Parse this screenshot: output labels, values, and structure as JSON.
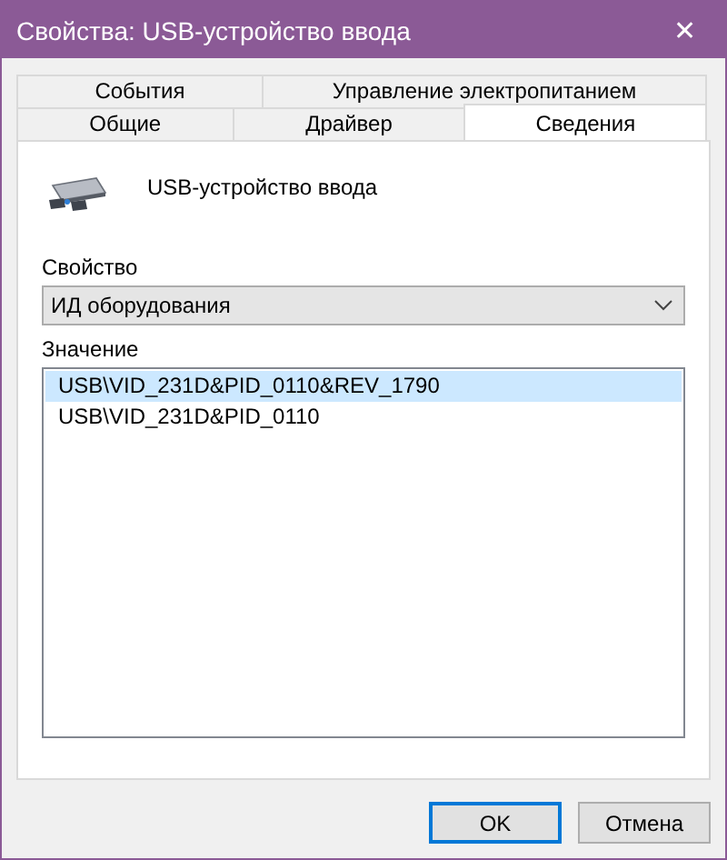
{
  "window": {
    "title": "Свойства: USB-устройство ввода",
    "close": "✕"
  },
  "tab_rows": [
    [
      {
        "label": "События",
        "selected": false
      },
      {
        "label": "Управление электропитанием",
        "selected": false
      }
    ],
    [
      {
        "label": "Общие",
        "selected": false
      },
      {
        "label": "Драйвер",
        "selected": false
      },
      {
        "label": "Сведения",
        "selected": true
      }
    ]
  ],
  "device": {
    "name": "USB-устройство ввода"
  },
  "property": {
    "label": "Свойство",
    "value": "ИД оборудования"
  },
  "value": {
    "label": "Значение",
    "items": [
      {
        "text": "USB\\VID_231D&PID_0110&REV_1790",
        "selected": true
      },
      {
        "text": "USB\\VID_231D&PID_0110",
        "selected": false
      }
    ]
  },
  "buttons": [
    {
      "label": "OK",
      "default": true
    },
    {
      "label": "Отмена",
      "default": false
    }
  ]
}
